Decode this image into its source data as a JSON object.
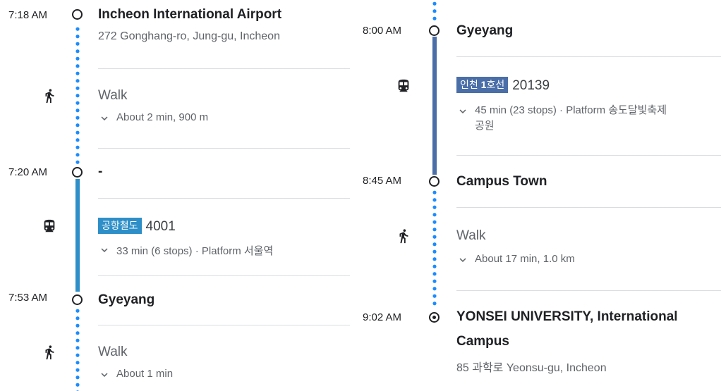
{
  "colors": {
    "walk_dots": "#1a8cff",
    "airport_rail": "#2e8fc8",
    "incheon_line1": "#4a6ea8",
    "text_primary": "#202124",
    "text_secondary": "#5f6368"
  },
  "left": {
    "stop1": {
      "time": "7:18 AM",
      "name": "Incheon International Airport",
      "address": "272 Gonghang-ro, Jung-gu, Incheon",
      "icon": "origin-circle-icon"
    },
    "walk1": {
      "mode": "Walk",
      "details": "About 2 min, 900 m",
      "icon": "walking-person-icon"
    },
    "stop2": {
      "time": "7:20 AM",
      "name": "-",
      "icon": "stop-circle-icon"
    },
    "transit1": {
      "line_name": "공항철도",
      "line_color": "#2e8fc8",
      "route_number": "4001",
      "details": "33 min (6 stops) · Platform 서울역",
      "icon": "train-icon"
    },
    "stop3": {
      "time": "7:53 AM",
      "name": "Gyeyang",
      "icon": "stop-circle-icon"
    },
    "walk2": {
      "mode": "Walk",
      "details": "About 1 min",
      "icon": "walking-person-icon"
    }
  },
  "right": {
    "stop4": {
      "time": "8:00 AM",
      "name": "Gyeyang",
      "icon": "stop-circle-icon"
    },
    "transit2": {
      "line_name_prefix": "인천 ",
      "line_name_bold": "1",
      "line_name_suffix": "호선",
      "line_color": "#4a6ea8",
      "route_number": "20139",
      "details_line1": "45 min (23 stops) · Platform 송도달빛축제",
      "details_line2": "공원",
      "icon": "train-icon"
    },
    "stop5": {
      "time": "8:45 AM",
      "name": "Campus Town",
      "icon": "stop-circle-icon"
    },
    "walk3": {
      "mode": "Walk",
      "details": "About 17 min, 1.0 km",
      "icon": "walking-person-icon"
    },
    "destination": {
      "time": "9:02 AM",
      "name_line1": "YONSEI UNIVERSITY, International",
      "name_line2": "Campus",
      "address": "85 과학로 Yeonsu-gu, Incheon",
      "icon": "destination-pin-icon"
    }
  }
}
